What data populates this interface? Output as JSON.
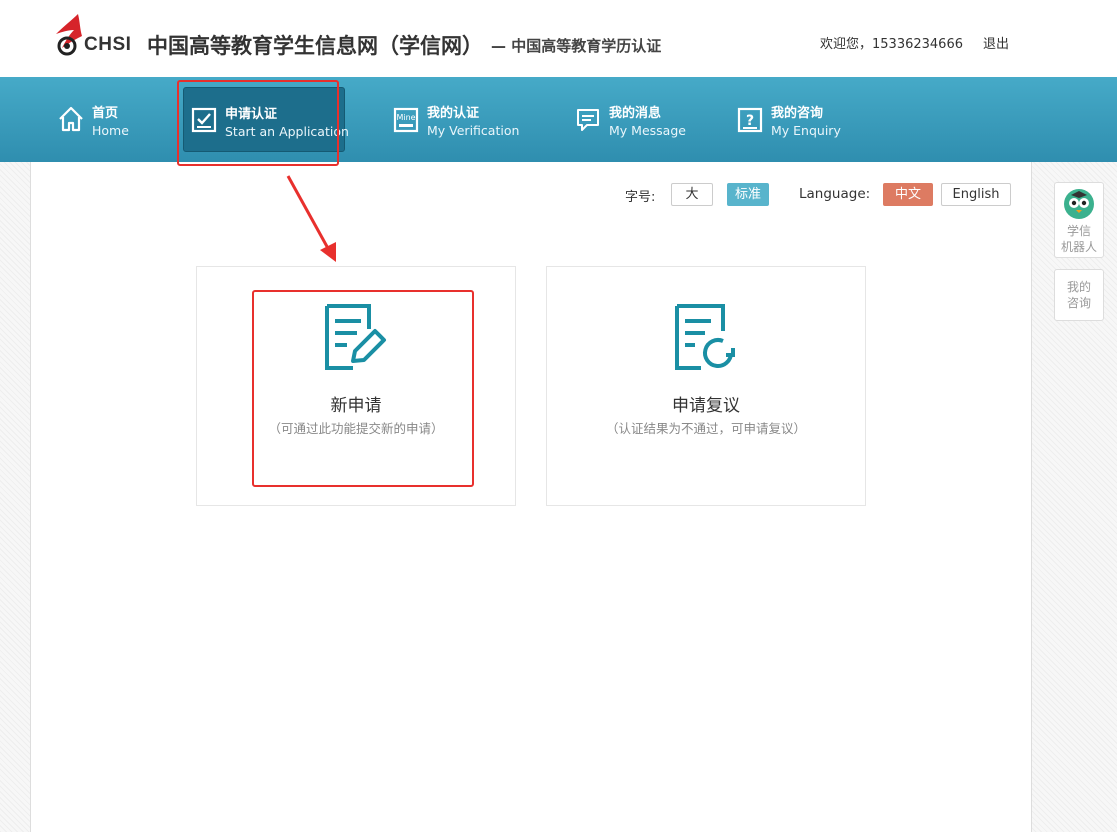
{
  "header": {
    "logo_text": "CHSI",
    "site_title": "中国高等教育学生信息网（学信网）",
    "site_subtitle": "— 中国高等教育学历认证",
    "welcome_text": "欢迎您，15336234666",
    "logout_label": "退出"
  },
  "nav": {
    "items": [
      {
        "zh": "首页",
        "en": "Home",
        "icon": "home-icon"
      },
      {
        "zh": "申请认证",
        "en": "Start an Application",
        "icon": "checkbox-icon"
      },
      {
        "zh": "我的认证",
        "en": "My Verification",
        "icon": "mine-icon"
      },
      {
        "zh": "我的消息",
        "en": "My Message",
        "icon": "message-icon"
      },
      {
        "zh": "我的咨询",
        "en": "My Enquiry",
        "icon": "question-icon"
      }
    ],
    "active": "申请认证"
  },
  "toolbar": {
    "font_label": "字号:",
    "font_large": "大",
    "font_standard": "标准",
    "language_label": "Language:",
    "lang_zh": "中文",
    "lang_en": "English"
  },
  "cards": [
    {
      "title": "新申请",
      "desc": "（可通过此功能提交新的申请）",
      "icon": "document-edit-icon"
    },
    {
      "title": "申请复议",
      "desc": "（认证结果为不通过，可申请复议）",
      "icon": "document-refresh-icon"
    }
  ],
  "side": {
    "robot_line1": "学信",
    "robot_line2": "机器人",
    "enquiry_line1": "我的",
    "enquiry_line2": "咨询"
  },
  "colors": {
    "nav_bg": "#3a9cbd",
    "nav_active": "#1d6e8c",
    "accent_blue": "#58b4cc",
    "accent_orange": "#dd7b62",
    "icon_teal": "#1a8fa4",
    "annotation_red": "#e8302d"
  }
}
